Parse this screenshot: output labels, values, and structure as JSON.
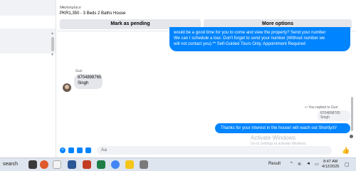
{
  "header": {
    "back_icon": "chevron-down-icon",
    "marketplace_label": "Marketplace",
    "listing_title": "PKR1,350 - 3 Beds 2 Baths House",
    "mark_pending_label": "Mark as pending",
    "more_options_label": "More options"
  },
  "messages": {
    "top_outgoing_lines": [
      "would be a good time for you to come and view the property? Send your number",
      "We can I schedule a tour.  Don't forget to send your number (Without number we",
      "will not contact you).** Self-Guided Tours Only. Appointment Required"
    ],
    "sender_name": "Guri",
    "incoming_lines": [
      "8704898765",
      "Singh"
    ],
    "replied_label": "You replied to Guri",
    "quoted_lines": [
      "8704898765",
      "Singh"
    ],
    "bottom_outgoing": "Thanks for your interest in the house! will reach out Shortly////"
  },
  "composer": {
    "placeholder": "Aa",
    "icons": [
      "plus-circle-icon",
      "photo-icon",
      "sticker-icon",
      "gif-icon",
      "thumbs-up-icon"
    ]
  },
  "watermark": {
    "title": "Activate Windows",
    "subtitle": "Go to Settings to activate Windows."
  },
  "taskbar": {
    "search_label": "search",
    "result_label": "Result",
    "time": "8:47 AM",
    "date": "4/12/2025"
  },
  "colors": {
    "outgoing_bubble": "#0084ff",
    "incoming_bubble": "#e4e6eb",
    "button_bg": "#e4e6eb"
  }
}
